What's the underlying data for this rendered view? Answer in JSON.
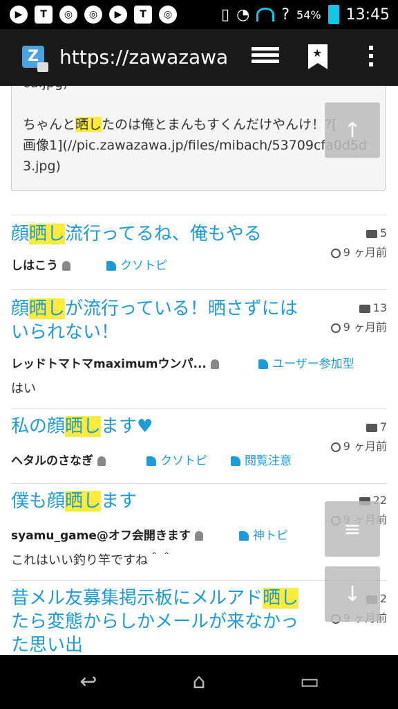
{
  "status_bar": {
    "left_icons": [
      "play-icon",
      "t-icon",
      "globe-search-icon",
      "globe-search-icon",
      "play-icon",
      "t-icon",
      "globe-search-icon"
    ],
    "battery": "54%",
    "time": "13:45"
  },
  "browser": {
    "url": "https://zawazawa.jp/"
  },
  "quote": {
    "line1": "cd.jpg)",
    "line2_pre": "ちゃんと",
    "line2_hl": "晒し",
    "line2_post": "たのは俺とまんもすくんだけやんけ！?[",
    "line3": "画像1](//pic.zawazawa.jp/files/mibach/53709cfa0d5d",
    "line4": "3.jpg)"
  },
  "threads": [
    {
      "title_pre": "顔",
      "title_hl": "晒し",
      "title_post": "流行ってるね、俺もやる",
      "comments": "5",
      "age": "9 ヶ月前",
      "author": "しはこう",
      "tags": [
        "クソトピ"
      ],
      "snippet": ""
    },
    {
      "title_pre": "顔",
      "title_hl": "晒し",
      "title_post": "が流行っている！晒さずにはいられない！",
      "comments": "13",
      "age": "9 ヶ月前",
      "author": "レッドトマトマmaximumウンパ...",
      "tags": [
        "ユーザー参加型"
      ],
      "snippet": "はい"
    },
    {
      "title_pre": "私の顔",
      "title_hl": "晒し",
      "title_post": "ます",
      "comments": "7",
      "age": "9 ヶ月前",
      "author": "ヘタルのさなぎ",
      "tags": [
        "クソトピ",
        "閲覧注意"
      ],
      "snippet": ""
    },
    {
      "title_pre": "僕も顔",
      "title_hl": "晒し",
      "title_post": "ます",
      "comments": "22",
      "age": "9 ヶ月前",
      "author": "syamu_game@オフ会開きます",
      "tags": [
        "神トピ"
      ],
      "snippet": "これはいい釣り竿ですね＾＾"
    },
    {
      "title_pre": "昔メル友募集掲示板にメルアド",
      "title_hl": "晒し",
      "title_post": "たら変態からしかメールが来なかった思い出",
      "comments": "2",
      "age": "9 ヶ月前",
      "author": "",
      "tags": [],
      "snippet": ""
    }
  ]
}
